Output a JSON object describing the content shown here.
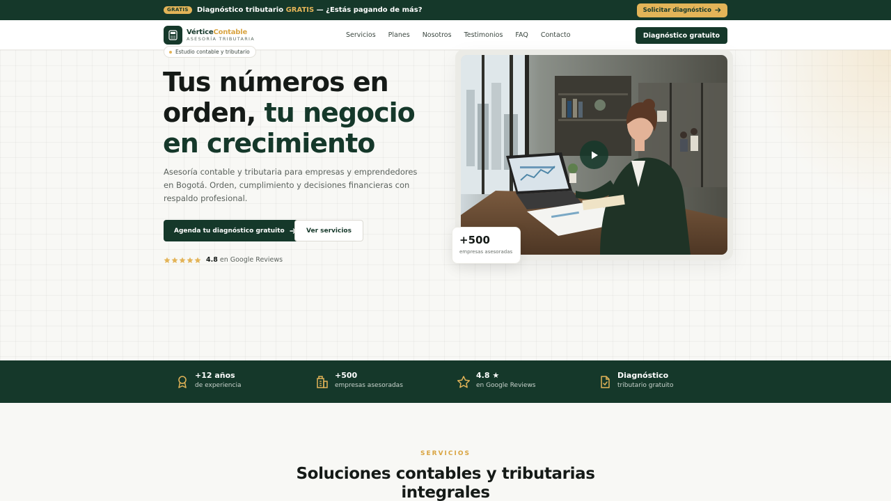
{
  "topbar": {
    "badge": "GRATIS",
    "text_before": "Diagnóstico tributario ",
    "text_accent": "GRATIS",
    "text_after": " — ¿Estás pagando de más?",
    "cta": "Solicitar diagnóstico"
  },
  "header": {
    "brand_part1": "Vértice",
    "brand_part2": "Contable",
    "brand_sub": "ASESORÍA TRIBUTARIA",
    "nav": [
      "Servicios",
      "Planes",
      "Nosotros",
      "Testimonios",
      "FAQ",
      "Contacto"
    ],
    "cta": "Diagnóstico gratuito"
  },
  "hero": {
    "eyebrow": "Estudio contable y tributario",
    "title_line1": "Tus números en",
    "title_line2a": "orden, ",
    "title_line2b": "tu negocio",
    "title_line3": "en crecimiento",
    "description": "Asesoría contable y tributaria para empresas y emprendedores en Bogotá. Orden, cumplimiento y decisiones financieras con respaldo profesional.",
    "primary_cta": "Agenda tu diagnóstico gratuito",
    "secondary_cta": "Ver servicios",
    "rating_value": "4.8",
    "rating_text": "en Google Reviews",
    "stars": 5,
    "stat_number": "+500",
    "stat_label": "empresas asesoradas"
  },
  "strip": [
    {
      "title": "+12 años",
      "subtitle": "de experiencia",
      "icon": "award-icon"
    },
    {
      "title": "+500",
      "subtitle": "empresas asesoradas",
      "icon": "building-icon"
    },
    {
      "title": "4.8 ★",
      "subtitle": "en Google Reviews",
      "icon": "star-icon"
    },
    {
      "title": "Diagnóstico",
      "subtitle": "tributario gratuito",
      "icon": "document-icon"
    }
  ],
  "services": {
    "eyebrow": "SERVICIOS",
    "title_line1": "Soluciones contables y tributarias",
    "title_line2": "integrales"
  },
  "colors": {
    "primary": "#15382a",
    "accent": "#e3b458",
    "background": "#f8f8f5"
  }
}
